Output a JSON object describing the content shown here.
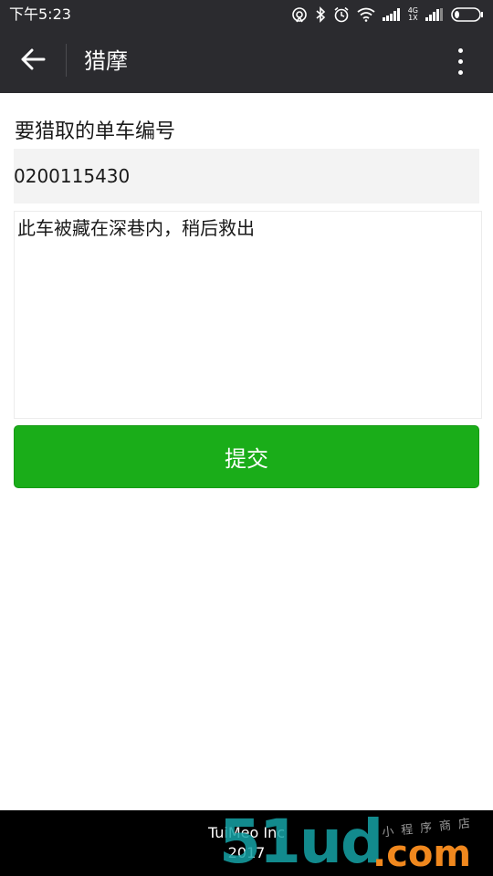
{
  "status_bar": {
    "time": "下午5:23",
    "network_top": "4G",
    "network_bottom": "1X"
  },
  "nav": {
    "title": "猎摩"
  },
  "form": {
    "label": "要猎取的单车编号",
    "bike_number_value": "0200115430",
    "note_value": "此车被藏在深巷内，稍后救出",
    "submit_label": "提交"
  },
  "footer": {
    "company": "TuiMeo Inc",
    "year": "2017"
  },
  "watermark": {
    "brand_digits": "51ud",
    "brand_suffix": ".com",
    "brand_script": "小程序商店"
  },
  "colors": {
    "bar_background": "#2b2b2f",
    "submit_button": "#1aad19",
    "input_background": "#f3f3f3",
    "footer_background": "#000000"
  },
  "icons": [
    "back-arrow-icon",
    "more-vertical-icon",
    "hotspot-icon",
    "bluetooth-icon",
    "alarm-icon",
    "wifi-icon",
    "signal-icon",
    "battery-icon"
  ],
  "status": {
    "battery_level": 0.15
  }
}
